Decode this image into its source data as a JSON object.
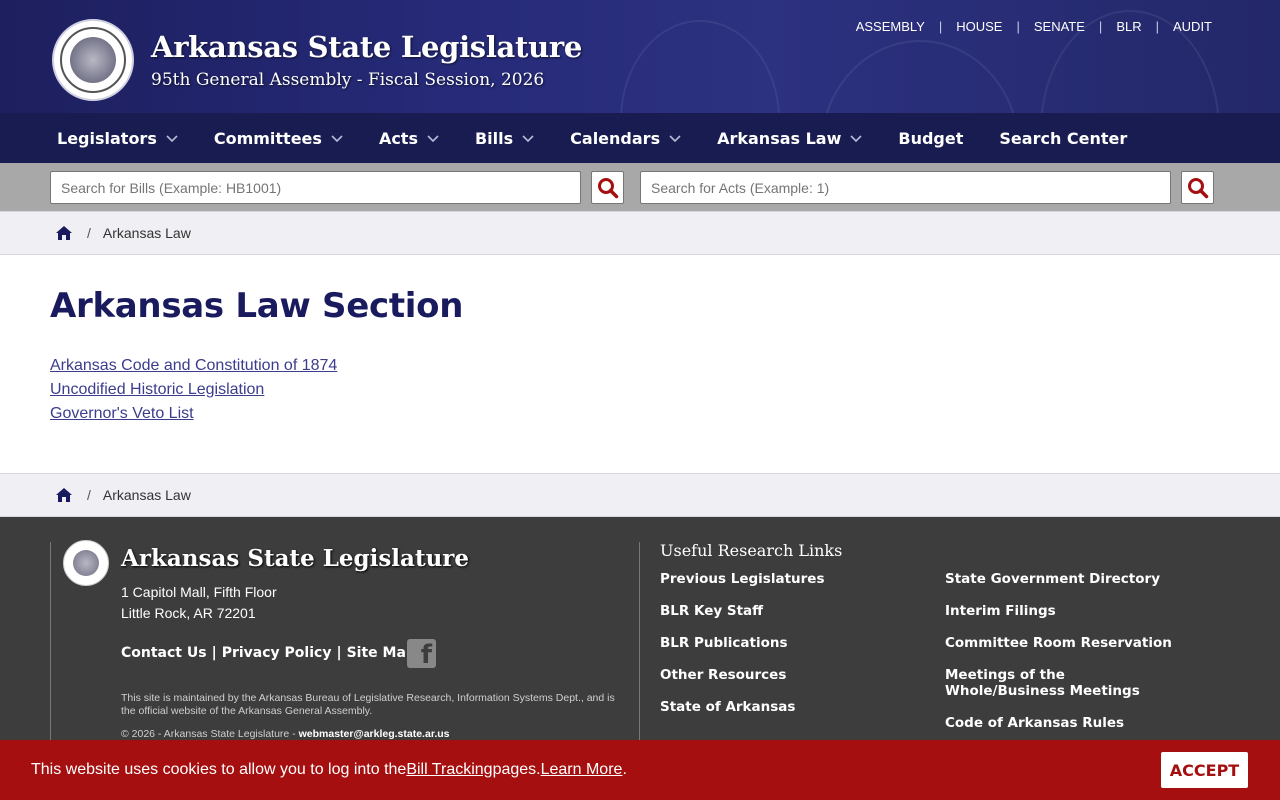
{
  "header": {
    "title": "Arkansas State Legislature",
    "subtitle": "95th General Assembly - Fiscal Session, 2026",
    "top_links": [
      "ASSEMBLY",
      "HOUSE",
      "SENATE",
      "BLR",
      "AUDIT"
    ]
  },
  "nav": {
    "items": [
      {
        "label": "Legislators",
        "dropdown": true
      },
      {
        "label": "Committees",
        "dropdown": true
      },
      {
        "label": "Acts",
        "dropdown": true
      },
      {
        "label": "Bills",
        "dropdown": true
      },
      {
        "label": "Calendars",
        "dropdown": true
      },
      {
        "label": "Arkansas Law",
        "dropdown": true
      },
      {
        "label": "Budget",
        "dropdown": false
      },
      {
        "label": "Search Center",
        "dropdown": false
      }
    ]
  },
  "search": {
    "bills_placeholder": "Search for Bills (Example: HB1001)",
    "acts_placeholder": "Search for Acts (Example: 1)"
  },
  "breadcrumb": {
    "current": "Arkansas Law"
  },
  "main": {
    "title": "Arkansas Law Section",
    "links": [
      "Arkansas Code and Constitution of 1874",
      "Uncodified Historic Legislation",
      "Governor's Veto List"
    ]
  },
  "footer": {
    "title": "Arkansas State Legislature",
    "address_line1": "1 Capitol Mall, Fifth Floor",
    "address_line2": "Little Rock, AR 72201",
    "contact": "Contact Us",
    "privacy": "Privacy Policy",
    "sitemap": "Site Map",
    "maintained": "This site is maintained by the Arkansas Bureau of Legislative Research, Information Systems Dept., and is the official website of the Arkansas General Assembly.",
    "copyright": "© 2026 - Arkansas State Legislature - ",
    "email": "webmaster@arkleg.state.ar.us",
    "useful_title": "Useful Research Links",
    "useful_col1": [
      "Previous Legislatures",
      "BLR Key Staff",
      "BLR Publications",
      "Other Resources",
      "State of Arkansas"
    ],
    "useful_col2": [
      "State Government Directory",
      "Interim Filings",
      "Committee Room Reservation",
      "Meetings of the Whole/Business Meetings",
      "Code of Arkansas Rules"
    ]
  },
  "cookie": {
    "text1": "This website uses cookies to allow you to log into the ",
    "link1": "Bill Tracking",
    "text2": " pages. ",
    "link2": "Learn More",
    "text3": ".",
    "accept": "ACCEPT"
  },
  "colors": {
    "header_bg": "#262a78",
    "nav_bg": "#191c50",
    "title_color": "#1a1b5e",
    "link_color": "#3b3d8c",
    "footer_bg": "#3d3d3d",
    "cookie_bg": "#a50f0f",
    "search_icon": "#a50f0f"
  }
}
